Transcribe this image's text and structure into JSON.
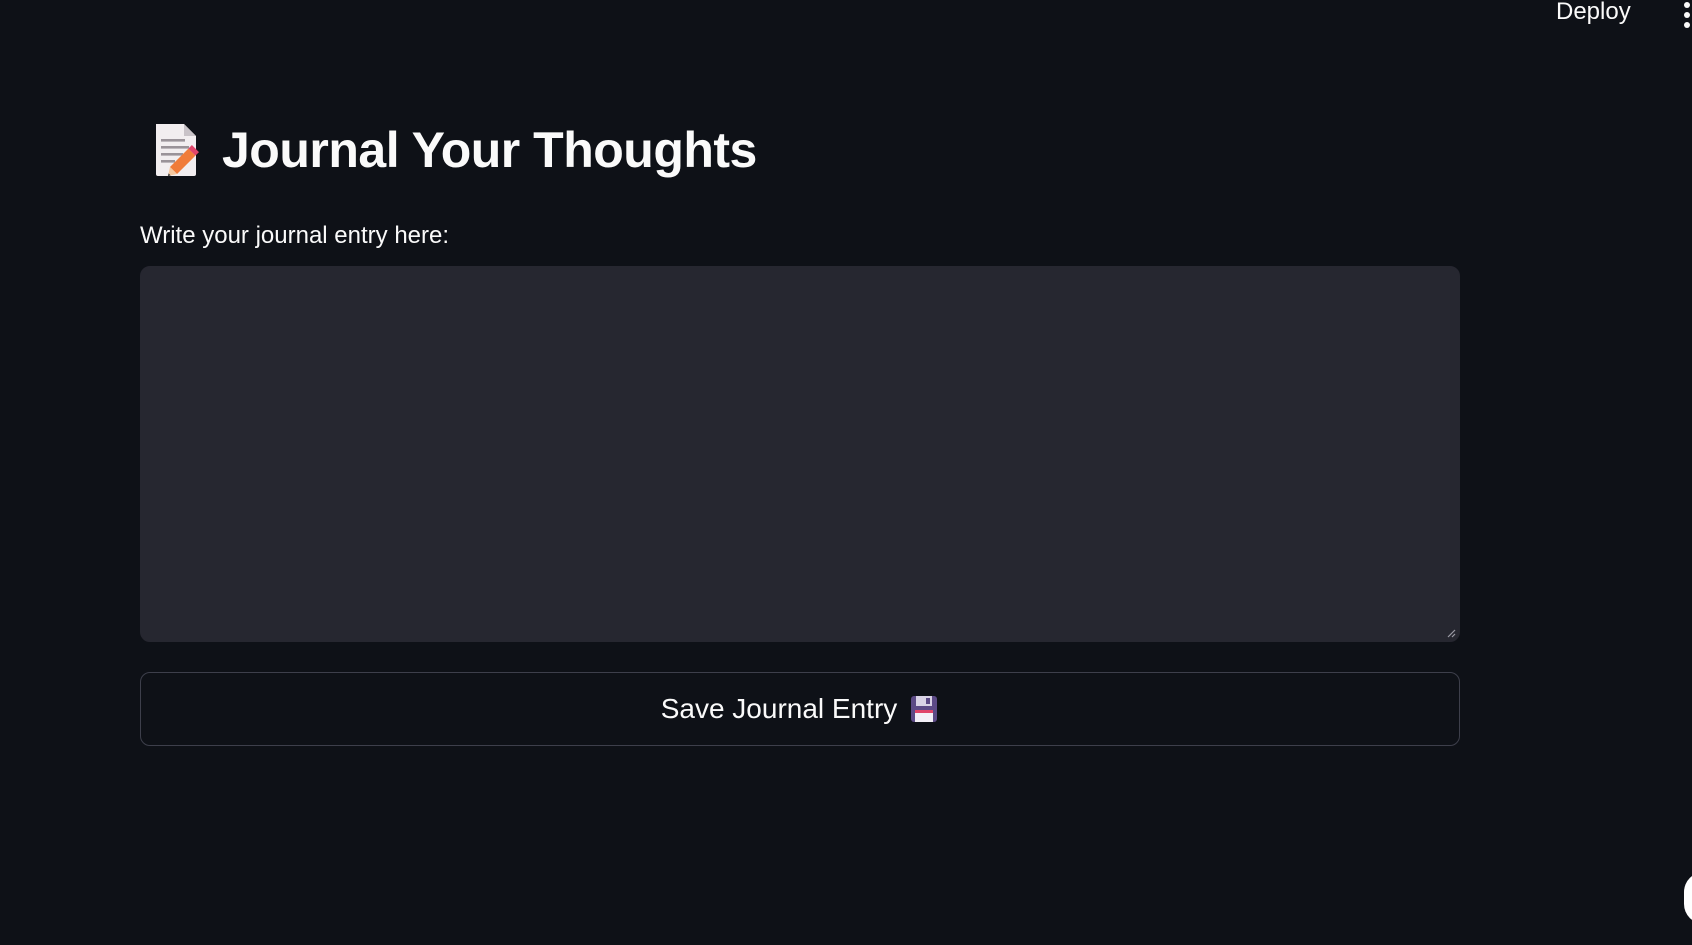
{
  "header": {
    "deploy_label": "Deploy",
    "menu_icon": "vertical-ellipsis-icon"
  },
  "main": {
    "title_icon": "memo-icon",
    "title": "Journal Your Thoughts",
    "entry_label": "Write your journal entry here:",
    "entry_value": "",
    "save_label": "Save Journal Entry",
    "save_icon": "floppy-disk-icon"
  },
  "colors": {
    "background": "#0e1117",
    "input_background": "#262730",
    "button_border": "#3d3f4b",
    "text": "#fafafa"
  }
}
